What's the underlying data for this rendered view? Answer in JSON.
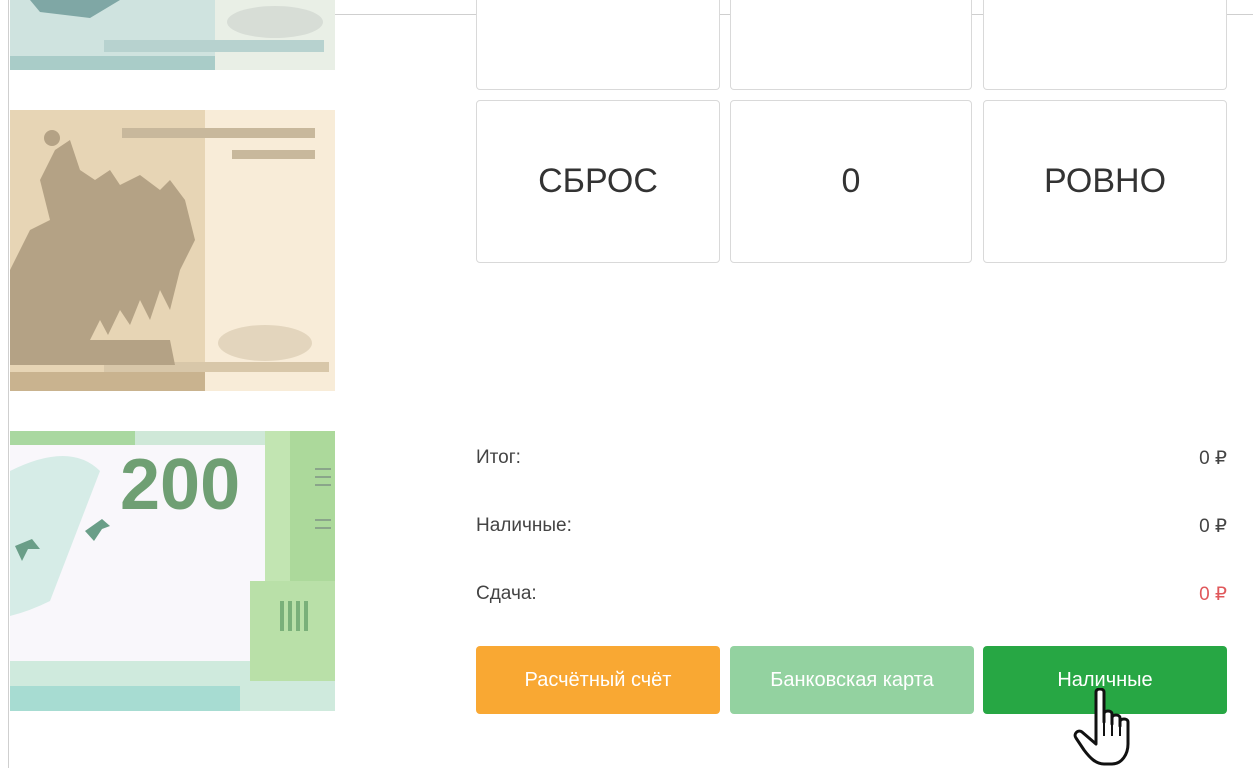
{
  "keypad": {
    "row_top_stubs": [
      "",
      "",
      ""
    ],
    "reset_label": "СБРОС",
    "zero_label": "0",
    "exact_label": "РОВНО"
  },
  "summary": {
    "total_label": "Итог:",
    "total_value": "0 ₽",
    "cash_label": "Наличные:",
    "cash_value": "0 ₽",
    "change_label": "Сдача:",
    "change_value": "0 ₽"
  },
  "payment": {
    "account_label": "Расчётный счёт",
    "card_label": "Банковская карта",
    "cash_label": "Наличные"
  },
  "bills": {
    "bill_200_label": "200"
  },
  "colors": {
    "orange": "#f9a833",
    "light_green": "#93d2a0",
    "green": "#27a744",
    "change_red": "#e0585b"
  }
}
